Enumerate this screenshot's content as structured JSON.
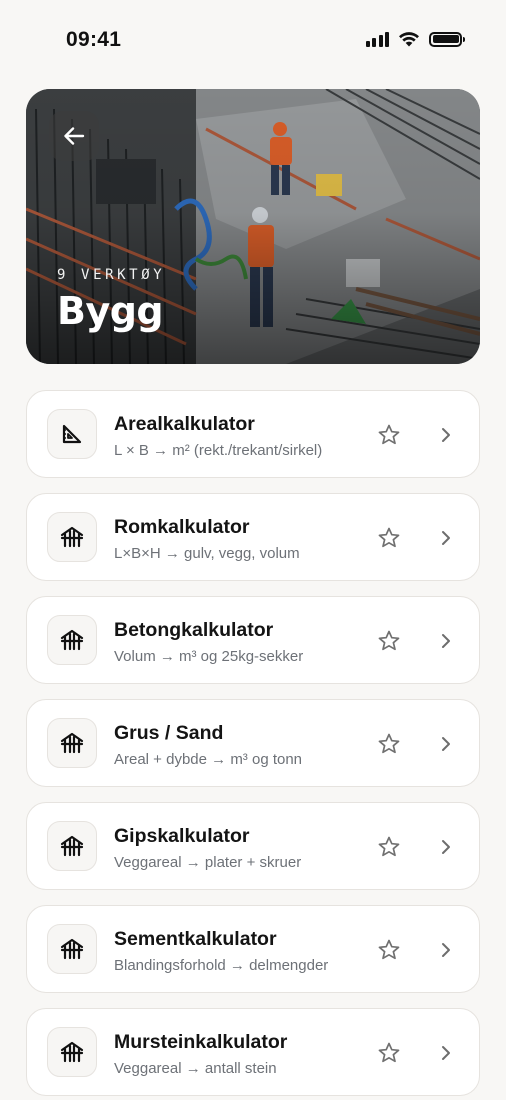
{
  "status_bar": {
    "time": "09:41"
  },
  "hero": {
    "kicker": "9 VERKTØY",
    "title": "Bygg"
  },
  "tools": [
    {
      "title": "Arealkalkulator",
      "subtitle": "L × B → m² (rekt./trekant/sirkel)",
      "icon": "set-square-icon"
    },
    {
      "title": "Romkalkulator",
      "subtitle": "L×B×H → gulv, vegg, volum",
      "icon": "building-icon"
    },
    {
      "title": "Betongkalkulator",
      "subtitle": "Volum → m³ og 25kg-sekker",
      "icon": "building-icon"
    },
    {
      "title": "Grus / Sand",
      "subtitle": "Areal + dybde → m³ og tonn",
      "icon": "building-icon"
    },
    {
      "title": "Gipskalkulator",
      "subtitle": "Veggareal → plater + skruer",
      "icon": "building-icon"
    },
    {
      "title": "Sementkalkulator",
      "subtitle": "Blandingsforhold → delmengder",
      "icon": "building-icon"
    },
    {
      "title": "Mursteinkalkulator",
      "subtitle": "Veggareal → antall stein",
      "icon": "building-icon"
    }
  ]
}
